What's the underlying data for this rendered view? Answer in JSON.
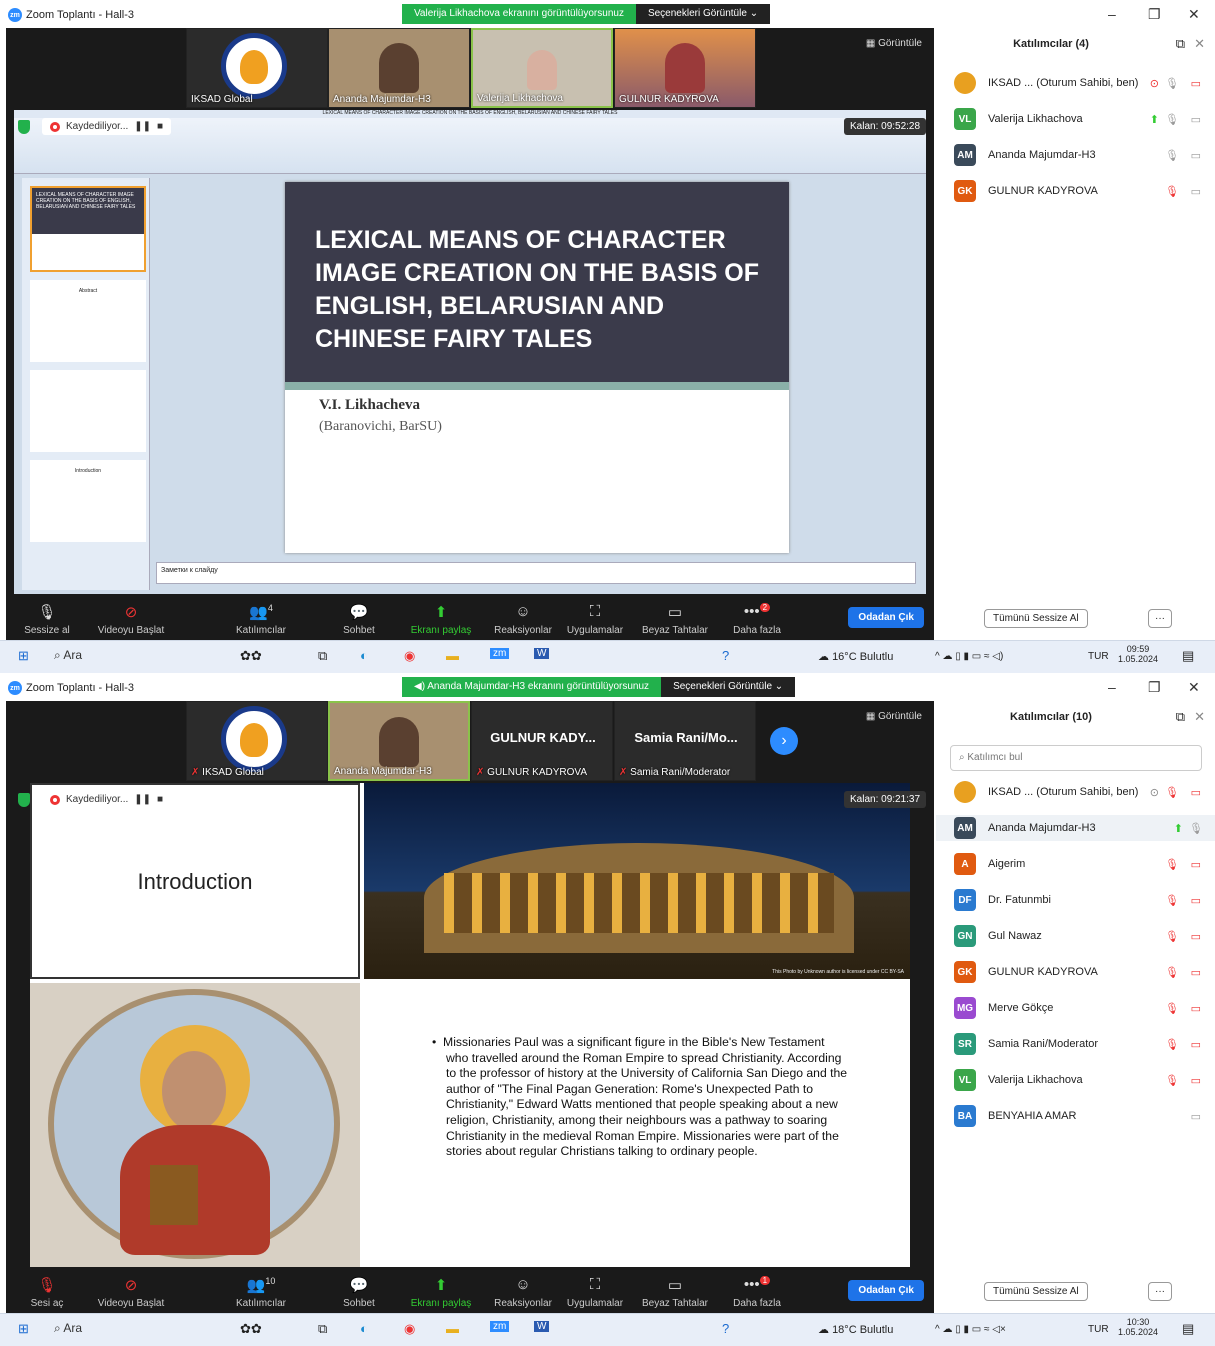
{
  "panel1": {
    "window_title": "Zoom Toplantı - Hall-3",
    "share_banner": "Valerija Likhachova ekranını görüntülüyorsunuz",
    "view_options": "Seçenekleri Görüntüle",
    "gallery_label": "Görüntüle",
    "thumbnails": [
      "IKSAD Global",
      "Ananda Majumdar-H3",
      "Valerija Likhachova",
      "GULNUR KADYROVA"
    ],
    "recording": "Kaydediliyor...",
    "timer": "Kalan: 09:52:28",
    "ppt_title": "LEXICAL MEANS OF CHARACTER IMAGE CREATION ON THE BASIS OF ENGLISH, BELARUSIAN AND CHINESE FAIRY TALES",
    "slide_title": "LEXICAL MEANS OF CHARACTER IMAGE CREATION ON THE BASIS OF ENGLISH, BELARUSIAN AND CHINESE FAIRY TALES",
    "slide_author": "V.I. Likhacheva",
    "slide_affil": "(Baranovichi, BarSU)",
    "notes_placeholder": "Заметки к слайду",
    "thumb_slides": [
      "LEXICAL MEANS OF CHARACTER IMAGE CREATION ON THE BASIS OF ENGLISH, BELARUSIAN AND CHINESE FAIRY TALES",
      "Abstract",
      "Introduction"
    ],
    "participants_title": "Katılımcılar (4)",
    "participants": [
      {
        "initials": "",
        "name": "IKSAD ... (Oturum Sahibi, ben)",
        "color": "#e8a020"
      },
      {
        "initials": "VL",
        "name": "Valerija Likhachova",
        "color": "#3aa64a"
      },
      {
        "initials": "AM",
        "name": "Ananda Majumdar-H3",
        "color": "#3a4a5a"
      },
      {
        "initials": "GK",
        "name": "GULNUR KADYROVA",
        "color": "#e05a10"
      }
    ],
    "mute_all": "Tümünü Sessize Al",
    "toolbar": {
      "mute": "Sessize al",
      "video": "Videoyu Başlat",
      "participants": "Katılımcılar",
      "participants_count": "4",
      "chat": "Sohbet",
      "share": "Ekranı paylaş",
      "reactions": "Reaksiyonlar",
      "apps": "Uygulamalar",
      "whiteboard": "Beyaz Tahtalar",
      "more": "Daha fazla",
      "more_badge": "2",
      "leave": "Odadan Çık"
    },
    "taskbar": {
      "search": "Ara",
      "weather": "16°C Bulutlu",
      "lang": "TUR",
      "time": "09:59",
      "date": "1.05.2024"
    }
  },
  "panel2": {
    "window_title": "Zoom Toplantı - Hall-3",
    "share_banner": "Ananda Majumdar-H3 ekranını görüntülüyorsunuz",
    "view_options": "Seçenekleri Görüntüle",
    "gallery_label": "Görüntüle",
    "thumbnails": [
      "IKSAD Global",
      "Ananda Majumdar-H3",
      "GULNUR KADYROVA",
      "Samia Rani/Moderator"
    ],
    "thumb_big_names": [
      "GULNUR KADY...",
      "Samia Rani/Mo..."
    ],
    "recording": "Kaydediliyor...",
    "timer": "Kalan: 09:21:37",
    "slide_heading": "Introduction",
    "photo_credit": "This Photo by Unknown author is licensed under CC BY-SA",
    "slide_text": "Missionaries Paul was a significant figure in the Bible's New Testament who travelled around the Roman Empire to spread Christianity. According to the professor of history at the University of California San Diego and the author of \"The Final Pagan Generation: Rome's Unexpected Path to Christianity,\" Edward Watts mentioned that people speaking about a new religion, Christianity, among their neighbours was a pathway to soaring Christianity in the medieval Roman Empire. Missionaries were part of the stories about regular Christians talking to ordinary people.",
    "participants_title": "Katılımcılar (10)",
    "search_placeholder": "Katılımcı bul",
    "participants": [
      {
        "initials": "",
        "name": "IKSAD ... (Oturum Sahibi, ben)",
        "color": "#e8a020"
      },
      {
        "initials": "AM",
        "name": "Ananda Majumdar-H3",
        "color": "#3a4a5a"
      },
      {
        "initials": "A",
        "name": "Aigerim",
        "color": "#e05a10"
      },
      {
        "initials": "DF",
        "name": "Dr. Fatunmbi",
        "color": "#2a7ad0"
      },
      {
        "initials": "GN",
        "name": "Gul Nawaz",
        "color": "#2a9a7a"
      },
      {
        "initials": "GK",
        "name": "GULNUR KADYROVA",
        "color": "#e05a10"
      },
      {
        "initials": "MG",
        "name": "Merve Gökçe",
        "color": "#9a4ad0"
      },
      {
        "initials": "SR",
        "name": "Samia Rani/Moderator",
        "color": "#2a9a7a"
      },
      {
        "initials": "VL",
        "name": "Valerija Likhachova",
        "color": "#3aa64a"
      },
      {
        "initials": "BA",
        "name": "BENYAHIA AMAR",
        "color": "#2a7ad0"
      }
    ],
    "mute_all": "Tümünü Sessize Al",
    "toolbar": {
      "mute": "Sesi aç",
      "video": "Videoyu Başlat",
      "participants": "Katılımcılar",
      "participants_count": "10",
      "chat": "Sohbet",
      "share": "Ekranı paylaş",
      "reactions": "Reaksiyonlar",
      "apps": "Uygulamalar",
      "whiteboard": "Beyaz Tahtalar",
      "more": "Daha fazla",
      "more_badge": "1",
      "leave": "Odadan Çık"
    },
    "taskbar": {
      "search": "Ara",
      "weather": "18°C Bulutlu",
      "lang": "TUR",
      "time": "10:30",
      "date": "1.05.2024"
    }
  }
}
